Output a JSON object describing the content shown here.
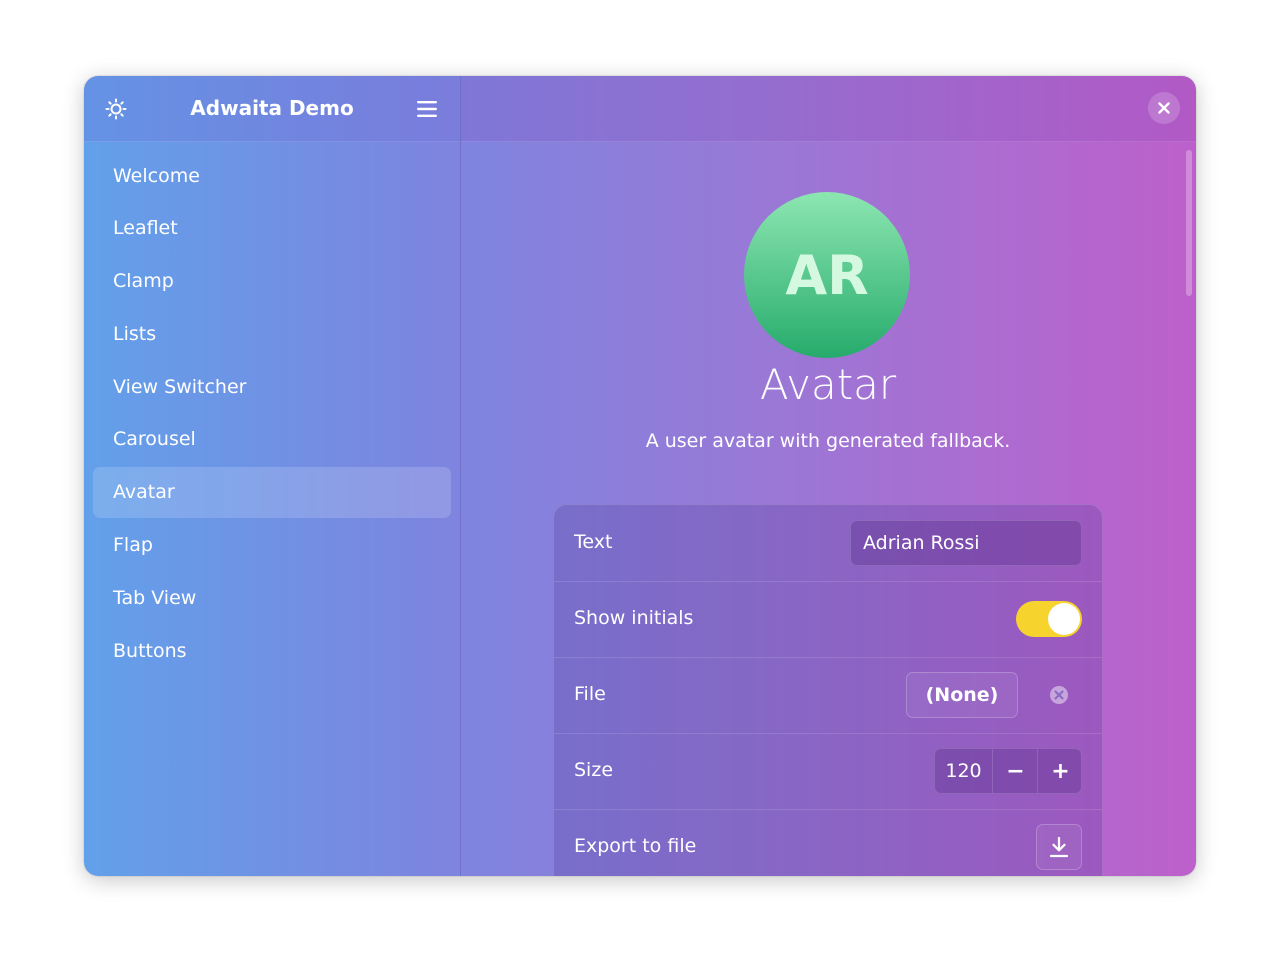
{
  "app": {
    "title": "Adwaita Demo",
    "theme_icon": "sun-icon",
    "menu_icon": "hamburger-menu-icon",
    "close_icon": "close-icon"
  },
  "sidebar": {
    "selected": "Avatar",
    "items": [
      {
        "label": "Welcome"
      },
      {
        "label": "Leaflet"
      },
      {
        "label": "Clamp"
      },
      {
        "label": "Lists"
      },
      {
        "label": "View Switcher"
      },
      {
        "label": "Carousel"
      },
      {
        "label": "Avatar"
      },
      {
        "label": "Flap"
      },
      {
        "label": "Tab View"
      },
      {
        "label": "Buttons"
      }
    ]
  },
  "page": {
    "avatar_initials": "AR",
    "avatar_color": "#2ec27e",
    "title": "Avatar",
    "description": "A user avatar with generated fallback."
  },
  "prefs": {
    "text": {
      "label": "Text",
      "value": "Adrian Rossi"
    },
    "show_initials": {
      "label": "Show initials",
      "on": true,
      "accent": "#f6d32d"
    },
    "file": {
      "label": "File",
      "button_label": "(None)",
      "clear_icon": "clear-circle-icon"
    },
    "size": {
      "label": "Size",
      "value": "120",
      "decrement": "−",
      "increment": "+"
    },
    "export": {
      "label": "Export to file",
      "icon": "download-icon"
    }
  }
}
